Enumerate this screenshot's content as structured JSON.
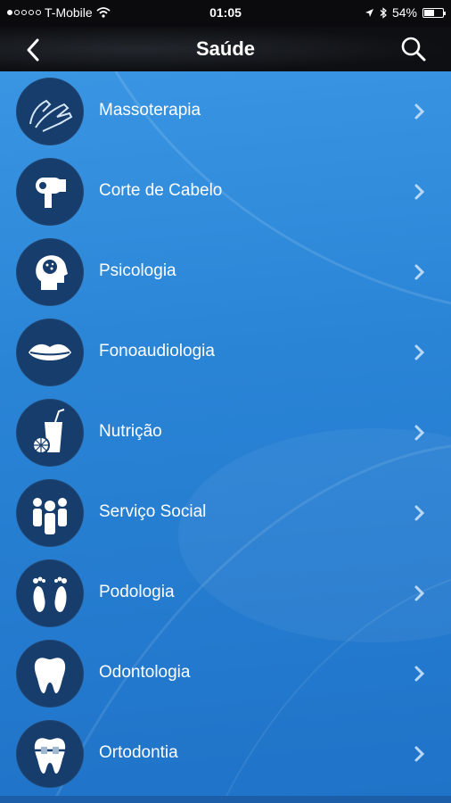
{
  "status_bar": {
    "carrier": "T-Mobile",
    "time": "01:05",
    "battery": "54%",
    "battery_level": 0.54,
    "icons": [
      "signal-dots-icon",
      "wifi-icon",
      "location-arrow-icon",
      "bluetooth-icon",
      "battery-icon"
    ]
  },
  "nav": {
    "title": "Saúde",
    "back_icon": "chevron-left-icon",
    "search_icon": "search-icon"
  },
  "items": [
    {
      "label": "Massoterapia",
      "icon": "hands-icon"
    },
    {
      "label": "Corte de Cabelo",
      "icon": "hair-dryer-icon"
    },
    {
      "label": "Psicologia",
      "icon": "head-profile-icon"
    },
    {
      "label": "Fonoaudiologia",
      "icon": "lips-icon"
    },
    {
      "label": "Nutrição",
      "icon": "juice-glass-icon"
    },
    {
      "label": "Serviço Social",
      "icon": "people-group-icon"
    },
    {
      "label": "Podologia",
      "icon": "feet-icon"
    },
    {
      "label": "Odontologia",
      "icon": "tooth-icon"
    },
    {
      "label": "Ortodontia",
      "icon": "braces-icon"
    }
  ],
  "colors": {
    "background": "#2f8ad8",
    "nav_bar": "#0d0f12",
    "icon_circle": "#163d6b",
    "text": "#ffffff",
    "chevron": "#b9d8f5"
  }
}
